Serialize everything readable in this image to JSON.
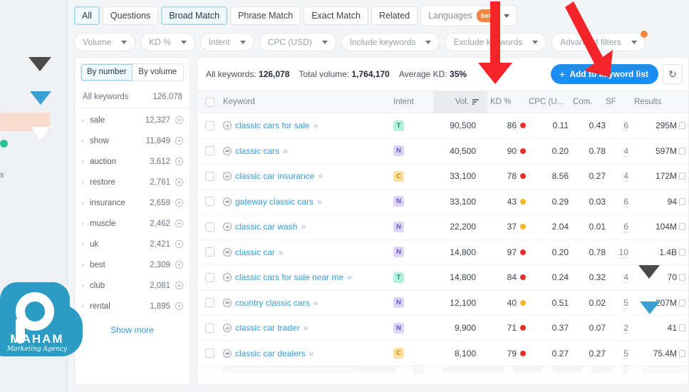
{
  "tabs": [
    {
      "label": "All",
      "selected": true
    },
    {
      "label": "Questions",
      "selected": false
    },
    {
      "label": "Broad Match",
      "selected": true
    },
    {
      "label": "Phrase Match",
      "selected": false
    },
    {
      "label": "Exact Match",
      "selected": false
    },
    {
      "label": "Related",
      "selected": false
    }
  ],
  "languages": {
    "label": "Languages",
    "badge": "beta"
  },
  "filters": [
    {
      "label": "Volume"
    },
    {
      "label": "KD %"
    },
    {
      "label": "Intent"
    },
    {
      "label": "CPC (USD)"
    },
    {
      "label": "Include keywords"
    },
    {
      "label": "Exclude keywords"
    },
    {
      "label": "Advanced filters"
    }
  ],
  "sidebar": {
    "segments": [
      {
        "label": "By number",
        "selected": true
      },
      {
        "label": "By volume",
        "selected": false
      }
    ],
    "total_label": "All keywords",
    "total_value": "126,078",
    "items": [
      {
        "label": "sale",
        "count": "12,327"
      },
      {
        "label": "show",
        "count": "11,849"
      },
      {
        "label": "auction",
        "count": "3,612"
      },
      {
        "label": "restore",
        "count": "2,761"
      },
      {
        "label": "insurance",
        "count": "2,659"
      },
      {
        "label": "muscle",
        "count": "2,462"
      },
      {
        "label": "uk",
        "count": "2,421"
      },
      {
        "label": "best",
        "count": "2,309"
      },
      {
        "label": "club",
        "count": "2,081"
      },
      {
        "label": "rental",
        "count": "1,895"
      }
    ],
    "show_more": "Show more"
  },
  "summary": {
    "all_keywords_label": "All keywords:",
    "all_keywords_value": "126,078",
    "total_volume_label": "Total volume:",
    "total_volume_value": "1,764,170",
    "average_kd_label": "Average KD:",
    "average_kd_value": "35%"
  },
  "actions": {
    "add_to_list": "Add to keyword list",
    "plus": "+",
    "refresh": "↻"
  },
  "table": {
    "columns": {
      "keyword": "Keyword",
      "intent": "Intent",
      "volume": "Vol.",
      "kd": "KD %",
      "cpc": "CPC (U...",
      "com": "Com.",
      "sf": "SF",
      "results": "Results"
    },
    "rows": [
      {
        "keyword": "classic cars for sale",
        "intent": "T",
        "volume": "90,500",
        "kd": "86",
        "kd_color": "#e8302a",
        "cpc": "0.11",
        "com": "0.43",
        "sf": "6",
        "results": "295M"
      },
      {
        "keyword": "classic cars",
        "intent": "N",
        "volume": "40,500",
        "kd": "90",
        "kd_color": "#e8302a",
        "cpc": "0.20",
        "com": "0.78",
        "sf": "4",
        "results": "597M"
      },
      {
        "keyword": "classic car insurance",
        "intent": "C",
        "volume": "33,100",
        "kd": "78",
        "kd_color": "#e8302a",
        "cpc": "8.56",
        "com": "0.27",
        "sf": "4",
        "results": "172M"
      },
      {
        "keyword": "gateway classic cars",
        "intent": "N",
        "volume": "33,100",
        "kd": "43",
        "kd_color": "#f2b824",
        "cpc": "0.29",
        "com": "0.03",
        "sf": "6",
        "results": "94"
      },
      {
        "keyword": "classic car wash",
        "intent": "N",
        "volume": "22,200",
        "kd": "37",
        "kd_color": "#f2b824",
        "cpc": "2.04",
        "com": "0.01",
        "sf": "6",
        "results": "104M"
      },
      {
        "keyword": "classic car",
        "intent": "N",
        "volume": "14,800",
        "kd": "97",
        "kd_color": "#e8302a",
        "cpc": "0.20",
        "com": "0.78",
        "sf": "10",
        "results": "1.4B"
      },
      {
        "keyword": "classic cars for sale near me",
        "intent": "T",
        "volume": "14,800",
        "kd": "84",
        "kd_color": "#e8302a",
        "cpc": "0.24",
        "com": "0.32",
        "sf": "4",
        "results": "70"
      },
      {
        "keyword": "country classic cars",
        "intent": "N",
        "volume": "12,100",
        "kd": "40",
        "kd_color": "#f2b824",
        "cpc": "0.51",
        "com": "0.02",
        "sf": "5",
        "results": "207M"
      },
      {
        "keyword": "classic car trader",
        "intent": "N",
        "volume": "9,900",
        "kd": "71",
        "kd_color": "#e8302a",
        "cpc": "0.37",
        "com": "0.07",
        "sf": "2",
        "results": "41"
      },
      {
        "keyword": "classic car dealers",
        "intent": "C",
        "volume": "8,100",
        "kd": "79",
        "kd_color": "#e8302a",
        "cpc": "0.27",
        "com": "0.27",
        "sf": "5",
        "results": "75.4M"
      }
    ]
  },
  "watermark": {
    "name": "MAHAM",
    "tagline": "Marketing Agency"
  },
  "colors": {
    "accent_blue": "#1b8ef2",
    "link_blue": "#2f9de0",
    "annotation_red": "#f4242a",
    "beta_orange": "#f5863f",
    "kd_high": "#e8302a",
    "kd_mid": "#f2b824",
    "watermark_blue": "#2c9cc4"
  }
}
